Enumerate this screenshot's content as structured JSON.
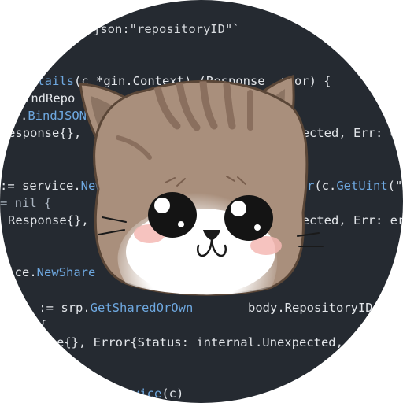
{
  "avatar": {
    "background": "#252a31",
    "code_lines": [
      {
        "parts": [
          {
            "text": "json:\"repositoryID\"`",
            "cls": "str"
          }
        ]
      },
      {
        "parts": [
          {
            "text": "etails",
            "cls": "fn"
          },
          {
            "text": "(c *gin.Context) (Response  rror) {",
            "cls": ""
          }
        ]
      },
      {
        "parts": [
          {
            "text": "indRepo",
            "cls": ""
          }
        ]
      },
      {
        "parts": [
          {
            "text": ".",
            "cls": ""
          },
          {
            "text": "BindJSON",
            "cls": "fn"
          },
          {
            "text": "(",
            "cls": ""
          }
        ]
      },
      {
        "parts": [
          {
            "text": "esponse{},",
            "cls": ""
          }
        ]
      },
      {
        "parts": [
          {
            "text": "xpected, Err: err",
            "cls": ""
          }
        ]
      },
      {
        "parts": [
          {
            "text": ":= service.",
            "cls": ""
          },
          {
            "text": "NewU",
            "cls": "fn"
          }
        ]
      },
      {
        "parts": [
          {
            "text": "User",
            "cls": "fn"
          },
          {
            "text": "(c.",
            "cls": ""
          },
          {
            "text": "GetUint",
            "cls": "fn"
          },
          {
            "text": "(\"",
            "cls": ""
          }
        ]
      },
      {
        "parts": [
          {
            "text": "= nil {",
            "cls": "kw"
          }
        ]
      },
      {
        "parts": [
          {
            "text": "Response{},",
            "cls": ""
          }
        ]
      },
      {
        "parts": [
          {
            "text": "xpected, Err: err",
            "cls": ""
          }
        ]
      },
      {
        "parts": [
          {
            "text": "vice.",
            "cls": ""
          },
          {
            "text": "NewShare",
            "cls": "fn"
          }
        ]
      },
      {
        "parts": [
          {
            "text": " := srp.",
            "cls": ""
          },
          {
            "text": "GetSharedOrOwn",
            "cls": "fn"
          }
        ]
      },
      {
        "parts": [
          {
            "text": "body.RepositoryID",
            "cls": ""
          }
        ]
      },
      {
        "parts": [
          {
            "text": "{",
            "cls": ""
          }
        ]
      },
      {
        "parts": [
          {
            "text": "e{}, Error{Status: internal.Unexpected, E",
            "cls": ""
          }
        ]
      },
      {
        "parts": [
          {
            "text": "vice",
            "cls": "fn"
          },
          {
            "text": "(c)",
            "cls": ""
          }
        ]
      }
    ]
  },
  "cat": {
    "fur_color": "#a98f7c",
    "stripe_color": "#8a6f5e",
    "outline_color": "#5a4637",
    "face_color": "#ffffff",
    "blush_color": "#f4b8b4"
  }
}
